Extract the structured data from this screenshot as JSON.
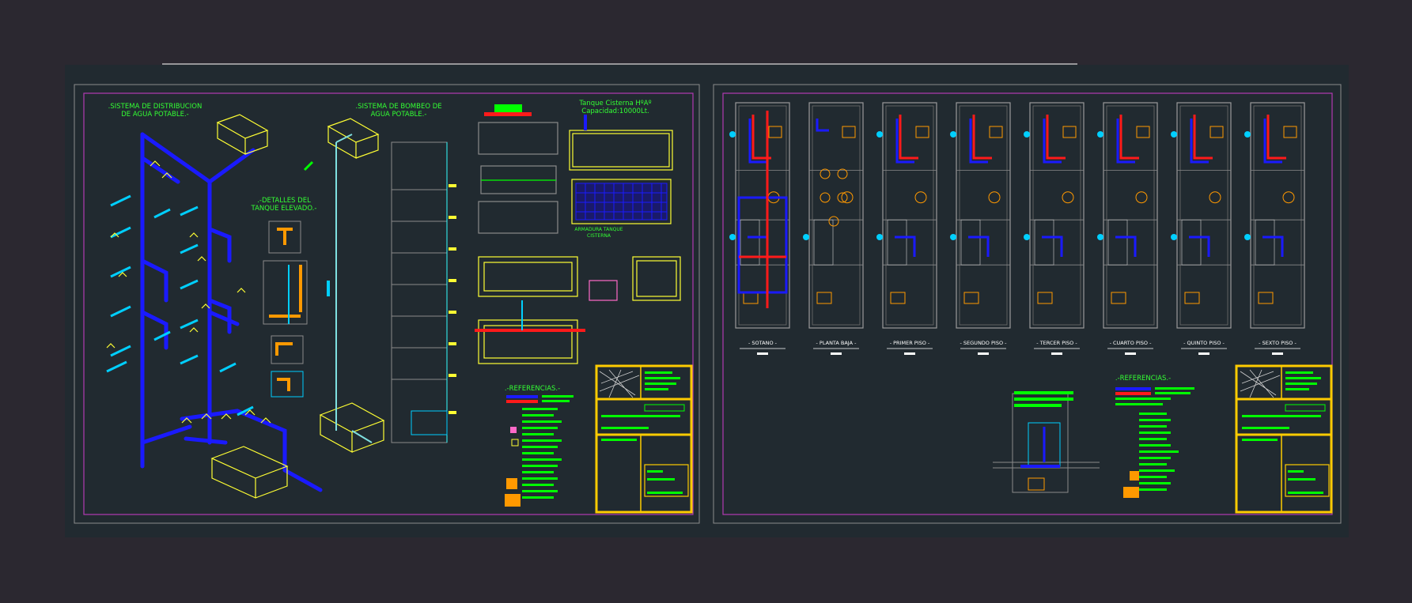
{
  "colors": {
    "background": "#2b2830",
    "sheet": "#212a30",
    "frame": "#b23ab2",
    "pipe_blue": "#1a1aff",
    "pipe_cyan": "#00cfff",
    "yellow": "#ffff33",
    "green": "#00ff00",
    "red": "#ff1a1a",
    "orange": "#ff9900",
    "gray": "#8a8a8a"
  },
  "sheet_left": {
    "titles": {
      "distribution": ".SISTEMA DE DISTRIBUCION",
      "distribution_2": "DE AGUA POTABLE.-",
      "pumping": ".SISTEMA DE BOMBEO DE",
      "pumping_2": "AGUA POTABLE.-",
      "tank_details": ".-DETALLES DEL",
      "tank_details_2": "TANQUE ELEVADO.-",
      "cistern": "Tanque Cisterna HºAº",
      "cistern_capacity": "Capacidad:10000Lt.",
      "armadura": "ARMADURA TANQUE",
      "armadura_2": "CISTERNA",
      "references": ".-REFERENCIAS.-"
    }
  },
  "sheet_right": {
    "floors": [
      {
        "name": "- SOTANO -"
      },
      {
        "name": "- PLANTA BAJA -"
      },
      {
        "name": "- PRIMER PISO -"
      },
      {
        "name": "- SEGUNDO PISO -"
      },
      {
        "name": "- TERCER PISO -"
      },
      {
        "name": "- CUARTO PISO -"
      },
      {
        "name": "- QUINTO PISO -"
      },
      {
        "name": "- SEXTO PISO -"
      }
    ],
    "references": ".-REFERENCIAS.-"
  }
}
